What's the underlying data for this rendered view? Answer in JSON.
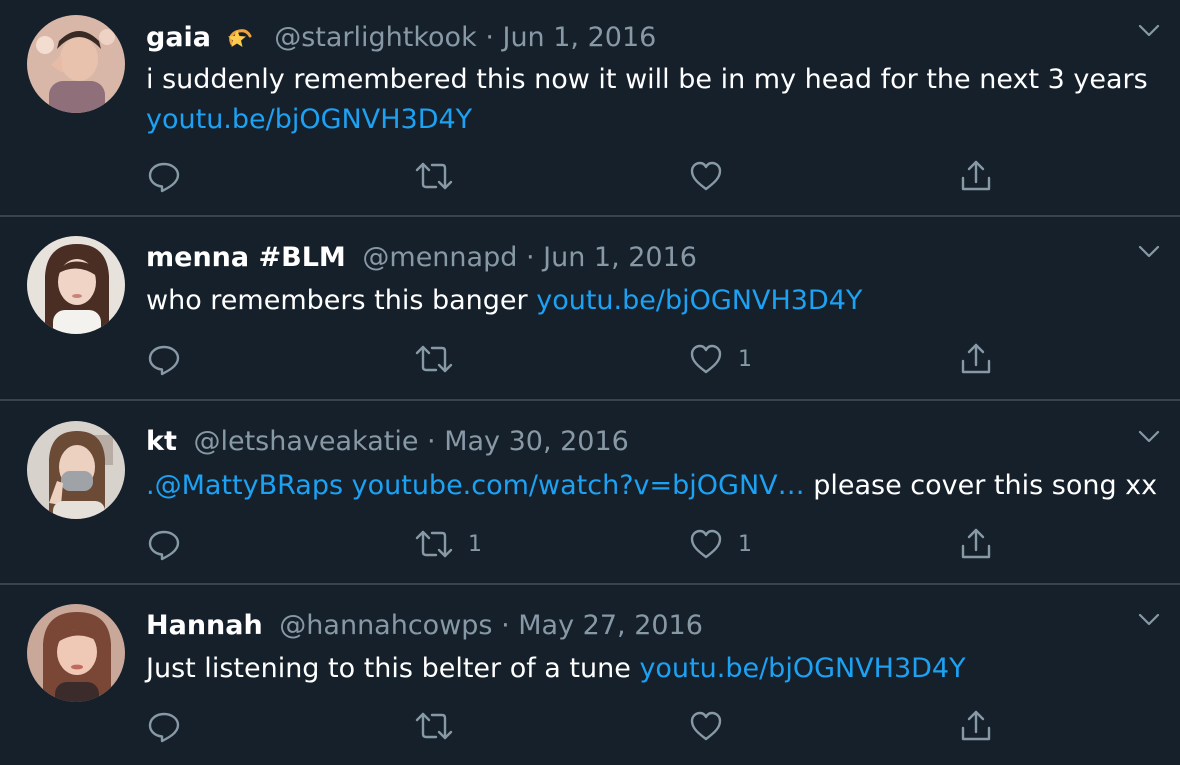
{
  "colors": {
    "background": "#15202b",
    "divider": "#38444d",
    "text": "#ffffff",
    "secondary": "#8899a6",
    "link": "#1da1f2"
  },
  "tweets": [
    {
      "name": "gaia",
      "emoji_icon": "dizzy-star-emoji",
      "handle": "@starlightkook",
      "separator": "·",
      "date": "Jun 1, 2016",
      "text_lines": [
        "i suddenly remembered this now it will be in my head for the next 3 years"
      ],
      "link": "youtu.be/bjOGNVH3D4Y",
      "retweets": "",
      "likes": ""
    },
    {
      "name": "menna #BLM",
      "handle": "@mennapd",
      "separator": "·",
      "date": "Jun 1, 2016",
      "text": "who remembers this banger ",
      "link": "youtu.be/bjOGNVH3D4Y",
      "retweets": "",
      "likes": "1"
    },
    {
      "name": "kt",
      "handle": "@letshaveakatie",
      "separator": "·",
      "date": "May 30, 2016",
      "text_prefix": ".",
      "mention": "@MattyBRaps",
      "link": "youtube.com/watch?v=bjOGNV…",
      "text_suffix": " please cover this song xx",
      "retweets": "1",
      "likes": "1"
    },
    {
      "name": "Hannah",
      "handle": "@hannahcowps",
      "separator": "·",
      "date": "May 27, 2016",
      "text": "Just listening to this belter of a tune ",
      "link": "youtu.be/bjOGNVH3D4Y",
      "retweets": "",
      "likes": ""
    }
  ]
}
